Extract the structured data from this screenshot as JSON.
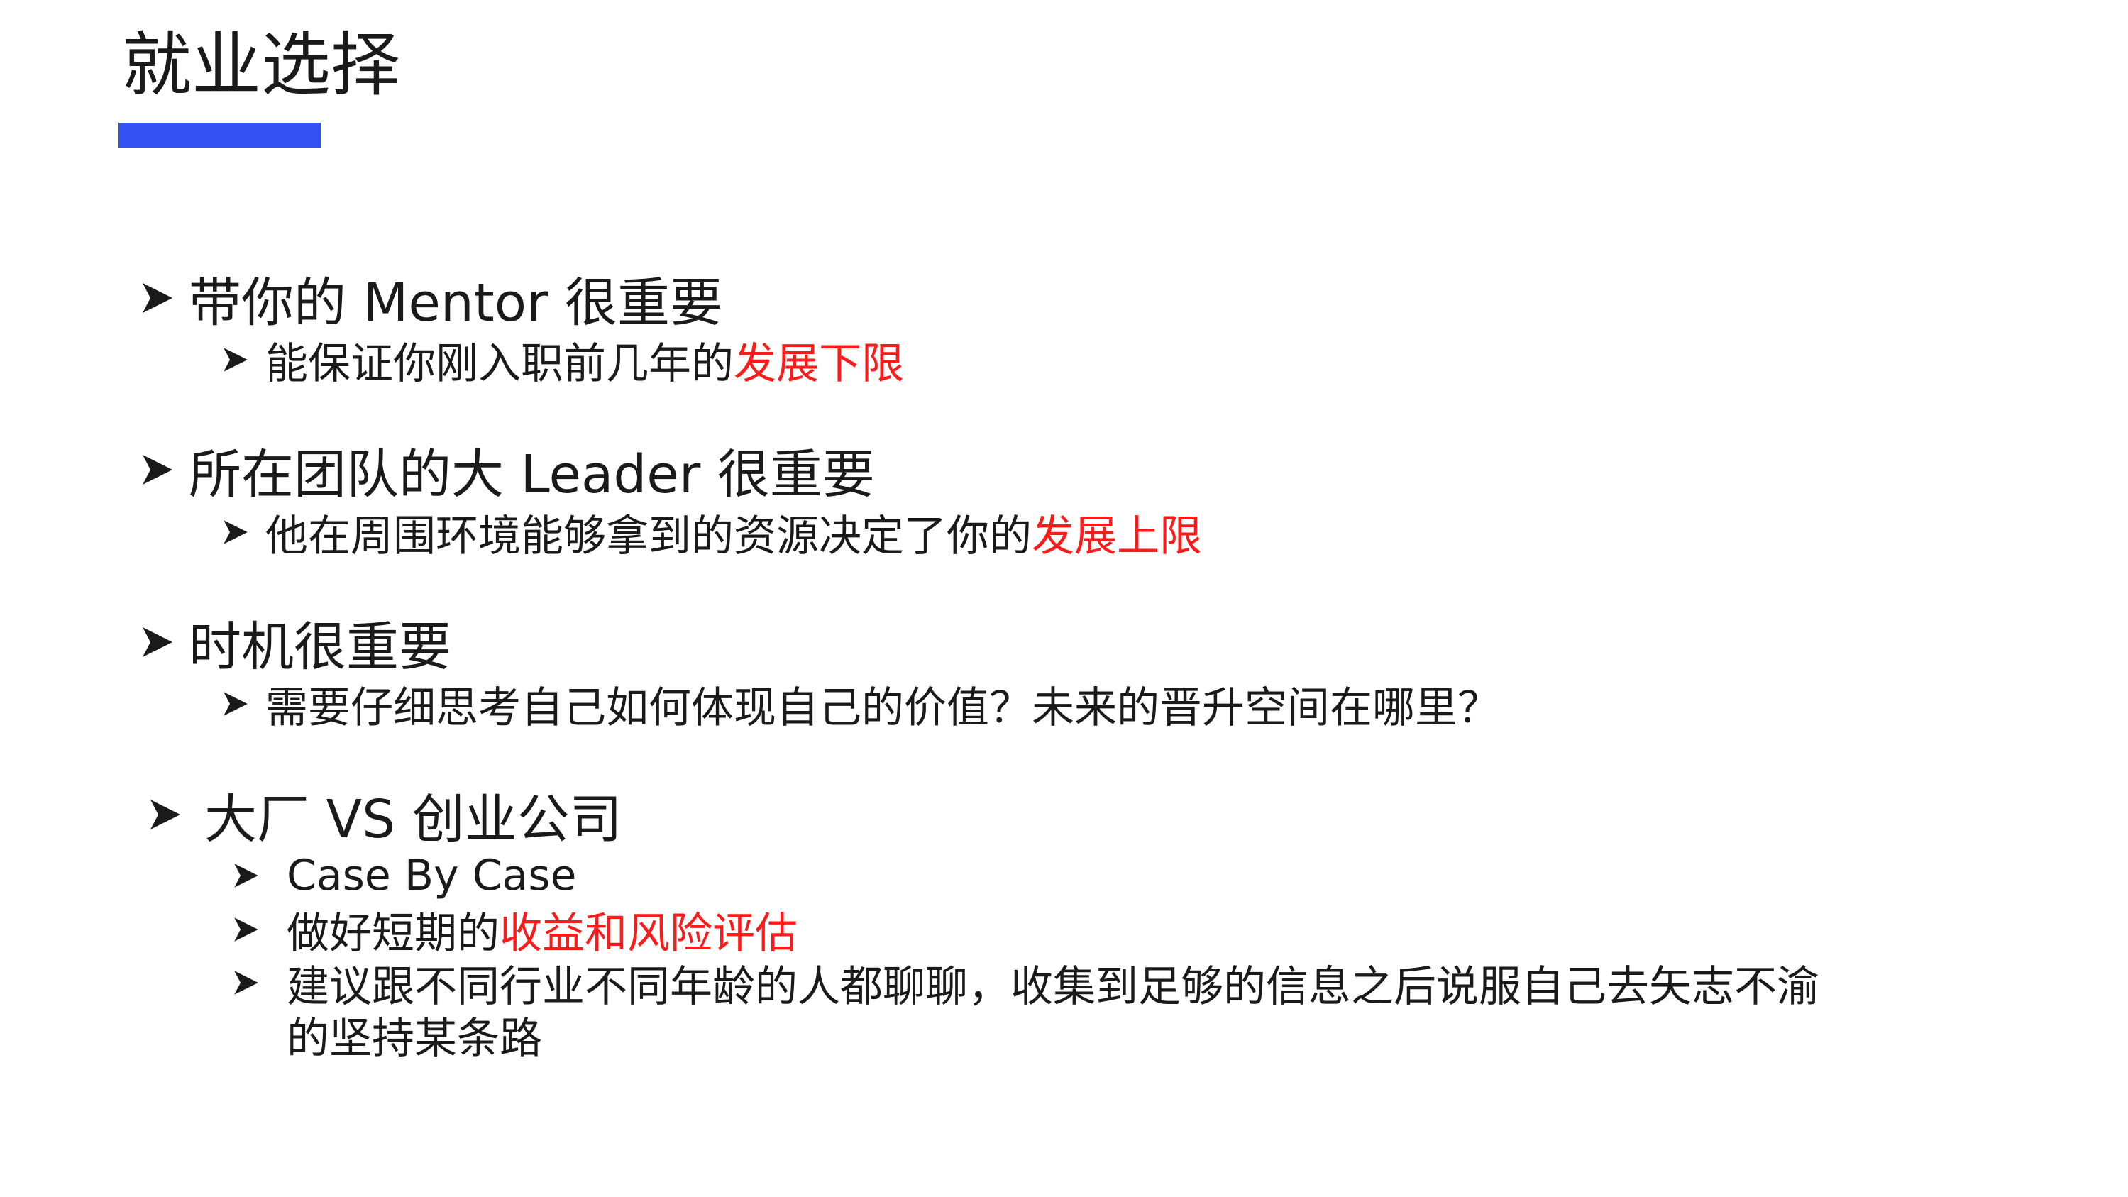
{
  "slide": {
    "title": "就业选择",
    "accent_color": "#3352f5",
    "highlight_color": "#ff1a1a",
    "bullet_icon": "arrowhead-bullet-icon"
  },
  "sections": [
    {
      "heading": "带你的 Mentor 很重要",
      "sub": [
        {
          "text": "能保证你刚入职前几年的",
          "highlight": "发展下限"
        }
      ]
    },
    {
      "heading": "所在团队的大 Leader 很重要",
      "sub": [
        {
          "text": "他在周围环境能够拿到的资源决定了你的",
          "highlight": "发展上限"
        }
      ]
    },
    {
      "heading": "时机很重要",
      "sub": [
        {
          "text": "需要仔细思考自己如何体现自己的价值？未来的晋升空间在哪里？"
        }
      ]
    },
    {
      "heading": "大厂 VS 创业公司",
      "sub": [
        {
          "text": "Case By Case"
        },
        {
          "text": "做好短期的",
          "highlight": "收益和风险评估"
        },
        {
          "text": "建议跟不同行业不同年龄的人都聊聊，收集到足够的信息之后说服自己去矢志不渝",
          "continuation": "的坚持某条路"
        }
      ]
    }
  ]
}
